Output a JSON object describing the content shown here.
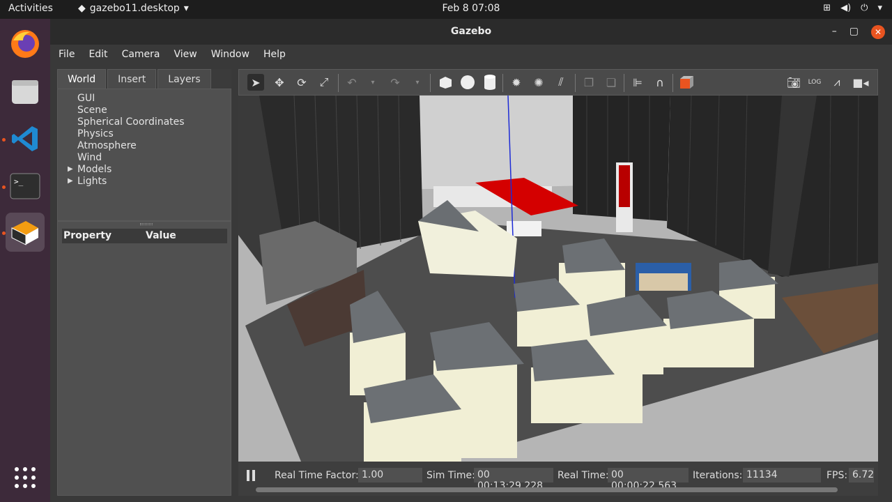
{
  "topbar": {
    "activities": "Activities",
    "app_menu": "gazebo11.desktop",
    "clock": "Feb 8  07:08"
  },
  "window": {
    "title": "Gazebo"
  },
  "menu": [
    "File",
    "Edit",
    "Camera",
    "View",
    "Window",
    "Help"
  ],
  "left_panel": {
    "tabs": [
      "World",
      "Insert",
      "Layers"
    ],
    "tree": [
      "GUI",
      "Scene",
      "Spherical Coordinates",
      "Physics",
      "Atmosphere",
      "Wind",
      "Models",
      "Lights"
    ],
    "property_header": "Property",
    "value_header": "Value"
  },
  "status": {
    "rtf_label": "Real Time Factor:",
    "rtf_value": "1.00",
    "sim_label": "Sim Time:",
    "sim_value": "00 00:13:29.228",
    "real_label": "Real Time:",
    "real_value": "00 00:00:22.563",
    "iter_label": "Iterations:",
    "iter_value": "11134",
    "fps_label": "FPS:",
    "fps_value": "6.72"
  },
  "colors": {
    "accent": "#e95420",
    "dock_bg": "#3d2a3a"
  }
}
